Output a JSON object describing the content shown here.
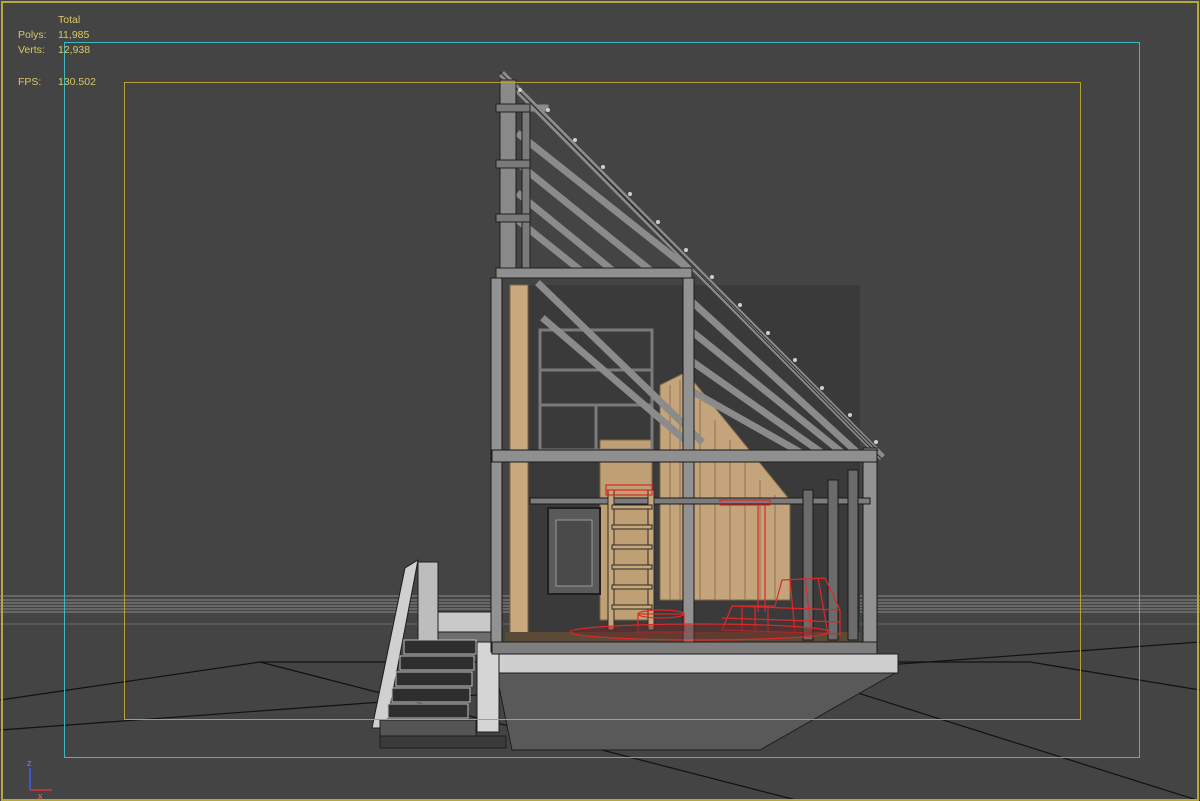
{
  "viewport": {
    "stats": {
      "total_label": "Total",
      "polys_label": "Polys:",
      "polys_value": "11,985",
      "verts_label": "Verts:",
      "verts_value": "12,938",
      "fps_label": "FPS:",
      "fps_value": "130.502"
    },
    "axis_gizmo": {
      "z_label": "z",
      "x_label": "x"
    },
    "colors": {
      "background": "#444444",
      "stats_text": "#d8c866",
      "safe_frame": "#3fb8c6",
      "action_frame": "#b8a234",
      "selection_wireframe": "#e02828",
      "wood": "#c4a47a"
    }
  }
}
